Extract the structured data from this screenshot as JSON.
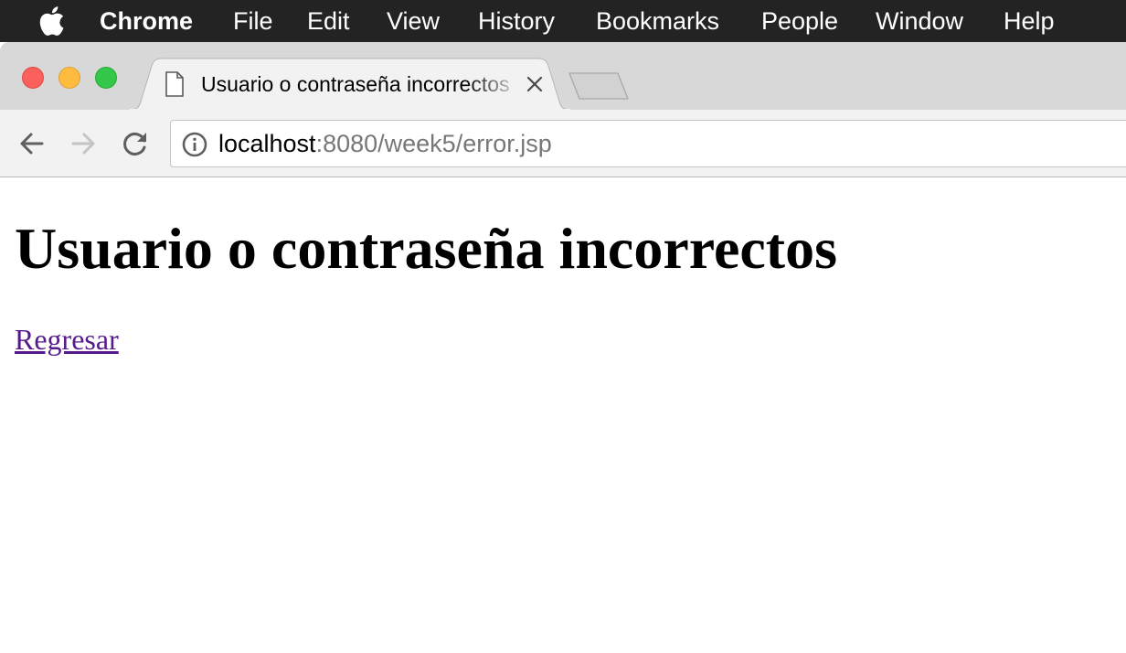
{
  "menubar": {
    "apple_icon": "apple-icon",
    "items": [
      {
        "label": "Chrome",
        "bold": true
      },
      {
        "label": "File"
      },
      {
        "label": "Edit"
      },
      {
        "label": "View"
      },
      {
        "label": "History"
      },
      {
        "label": "Bookmarks"
      },
      {
        "label": "People"
      },
      {
        "label": "Window"
      },
      {
        "label": "Help"
      }
    ]
  },
  "tab": {
    "title": "Usuario o contraseña incorrectos",
    "icon": "document-icon",
    "close_icon": "close-icon"
  },
  "toolbar": {
    "back_icon": "back-arrow-icon",
    "forward_icon": "forward-arrow-icon",
    "reload_icon": "reload-icon",
    "info_icon": "info-icon",
    "url_host": "localhost",
    "url_rest": ":8080/week5/error.jsp"
  },
  "page": {
    "heading": "Usuario o contraseña incorrectos",
    "link": "Regresar",
    "link_color": "#551a8b"
  },
  "colors": {
    "menubar_bg": "#232323",
    "traffic_red": "#fc605c",
    "traffic_yellow": "#fdbc40",
    "traffic_green": "#34c84a"
  }
}
